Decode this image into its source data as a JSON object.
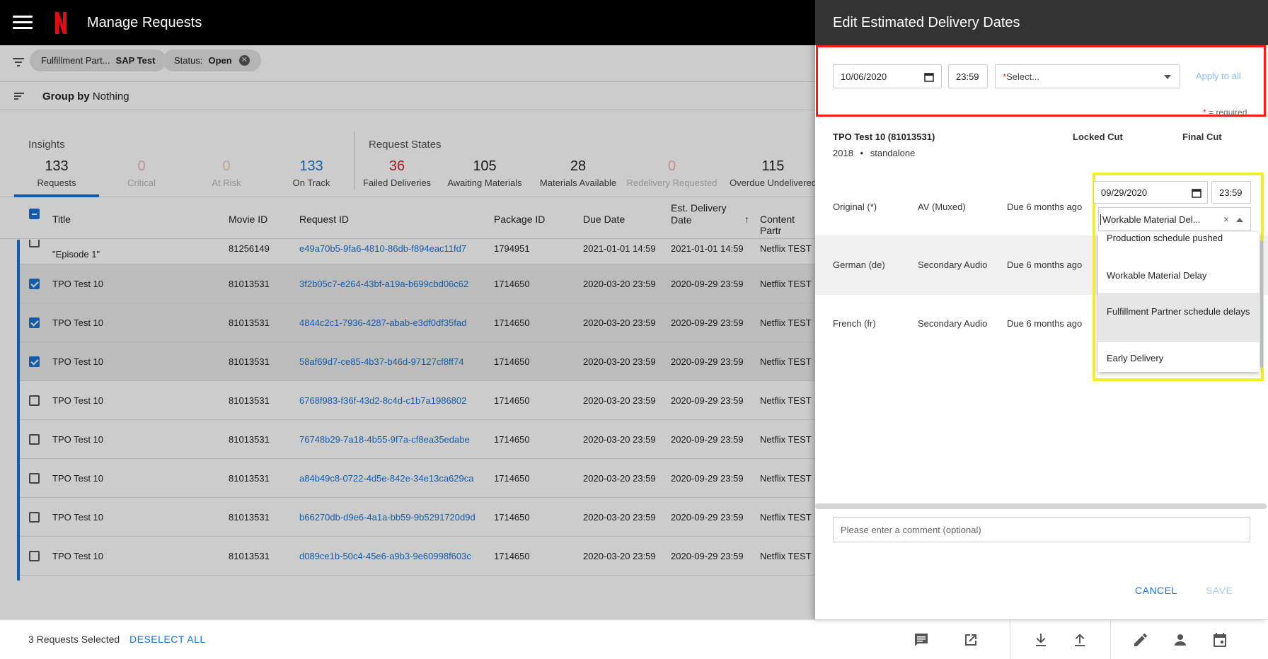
{
  "app": {
    "title": "Manage Requests"
  },
  "filters": {
    "chip1_key": "Fulfillment Part...",
    "chip1_val": "SAP Test",
    "chip2_key": "Status:",
    "chip2_val": "Open"
  },
  "group": {
    "label": "Group by",
    "value": "Nothing"
  },
  "insights": {
    "title": "Insights",
    "items": [
      {
        "n": "133",
        "label": "Requests"
      },
      {
        "n": "0",
        "label": "Critical"
      },
      {
        "n": "0",
        "label": "At Risk"
      },
      {
        "n": "133",
        "label": "On Track"
      }
    ]
  },
  "states": {
    "title": "Request States",
    "items": [
      {
        "n": "36",
        "label": "Failed Deliveries"
      },
      {
        "n": "105",
        "label": "Awaiting Materials"
      },
      {
        "n": "28",
        "label": "Materials Available"
      },
      {
        "n": "0",
        "label": "Redelivery Requested"
      },
      {
        "n": "115",
        "label": "Overdue Undelivered"
      }
    ]
  },
  "table": {
    "headers": {
      "title": "Title",
      "movie_id": "Movie ID",
      "request_id": "Request ID",
      "package_id": "Package ID",
      "due_date": "Due Date",
      "est_delivery_1": "Est. Delivery",
      "est_delivery_2": "Date",
      "content_partner": "Content Partr",
      "sort_arrow": "↑"
    },
    "rows": [
      {
        "title": "\"Episode 1\"",
        "movie": "81256149",
        "req": "e49a70b5-9fa6-4810-86db-f894eac11fd7",
        "pkg": "1794951",
        "due": "2021-01-01 14:59",
        "est": "2021-01-01 14:59",
        "partner": "Netflix TEST",
        "checked": false
      },
      {
        "title": "TPO Test 10",
        "movie": "81013531",
        "req": "3f2b05c7-e264-43bf-a19a-b699cbd06c62",
        "pkg": "1714650",
        "due": "2020-03-20 23:59",
        "est": "2020-09-29 23:59",
        "partner": "Netflix TEST",
        "checked": true
      },
      {
        "title": "TPO Test 10",
        "movie": "81013531",
        "req": "4844c2c1-7936-4287-abab-e3df0df35fad",
        "pkg": "1714650",
        "due": "2020-03-20 23:59",
        "est": "2020-09-29 23:59",
        "partner": "Netflix TEST",
        "checked": true
      },
      {
        "title": "TPO Test 10",
        "movie": "81013531",
        "req": "58af69d7-ce85-4b37-b46d-97127cf8ff74",
        "pkg": "1714650",
        "due": "2020-03-20 23:59",
        "est": "2020-09-29 23:59",
        "partner": "Netflix TEST",
        "checked": true
      },
      {
        "title": "TPO Test 10",
        "movie": "81013531",
        "req": "6768f983-f36f-43d2-8c4d-c1b7a1986802",
        "pkg": "1714650",
        "due": "2020-03-20 23:59",
        "est": "2020-09-29 23:59",
        "partner": "Netflix TEST",
        "checked": false
      },
      {
        "title": "TPO Test 10",
        "movie": "81013531",
        "req": "76748b29-7a18-4b55-9f7a-cf8ea35edabe",
        "pkg": "1714650",
        "due": "2020-03-20 23:59",
        "est": "2020-09-29 23:59",
        "partner": "Netflix TEST",
        "checked": false
      },
      {
        "title": "TPO Test 10",
        "movie": "81013531",
        "req": "a84b49c8-0722-4d5e-842e-34e13ca629ca",
        "pkg": "1714650",
        "due": "2020-03-20 23:59",
        "est": "2020-09-29 23:59",
        "partner": "Netflix TEST",
        "checked": false
      },
      {
        "title": "TPO Test 10",
        "movie": "81013531",
        "req": "b66270db-d9e6-4a1a-bb59-9b5291720d9d",
        "pkg": "1714650",
        "due": "2020-03-20 23:59",
        "est": "2020-09-29 23:59",
        "partner": "Netflix TEST",
        "checked": false
      },
      {
        "title": "TPO Test 10",
        "movie": "81013531",
        "req": "d089ce1b-50c4-45e6-a9b3-9e60998f603c",
        "pkg": "1714650",
        "due": "2020-03-20 23:59",
        "est": "2020-09-29 23:59",
        "partner": "Netflix TEST",
        "checked": false
      }
    ]
  },
  "bottom": {
    "selected": "3 Requests Selected",
    "deselect": "DESELECT ALL"
  },
  "drawer": {
    "title": "Edit Estimated Delivery Dates",
    "apply_date": "10/06/2020",
    "apply_time": "23:59",
    "apply_select_star": "*",
    "apply_select": "Select...",
    "apply_all": "Apply to all",
    "required_star": "*",
    "required_note": " = required",
    "package_title": "TPO Test 10 (81013531)",
    "package_year": "2018",
    "package_type": "standalone",
    "col_locked": "Locked Cut",
    "col_final": "Final Cut",
    "rows": [
      {
        "name": "Original (*)",
        "type": "AV (Muxed)",
        "due": "Due 6 months ago"
      },
      {
        "name": "German (de)",
        "type": "Secondary Audio",
        "due": "Due 6 months ago"
      },
      {
        "name": "French (fr)",
        "type": "Secondary Audio",
        "due": "Due 6 months ago"
      }
    ],
    "row_date": "09/29/2020",
    "row_time": "23:59",
    "reason_value": "Workable Material Del...",
    "reason_clear": "×",
    "menu": [
      "Production schedule pushed",
      "Workable Material Delay",
      "Fulfillment Partner schedule delays",
      "Early Delivery"
    ],
    "comment_placeholder": "Please enter a comment (optional)",
    "cancel": "CANCEL",
    "save": "SAVE"
  },
  "colors": {
    "accent": "#1a73d1",
    "danger": "#c62828",
    "netflix_red": "#e50914",
    "highlight_red": "#ff1a1a",
    "highlight_yellow": "#f2ee2c"
  },
  "icons": [
    "menu-icon",
    "netflix-logo",
    "filter-icon",
    "sort-icon",
    "comment-icon",
    "open-external-icon",
    "download-icon",
    "upload-icon",
    "edit-icon",
    "person-icon",
    "calendar-icon"
  ]
}
